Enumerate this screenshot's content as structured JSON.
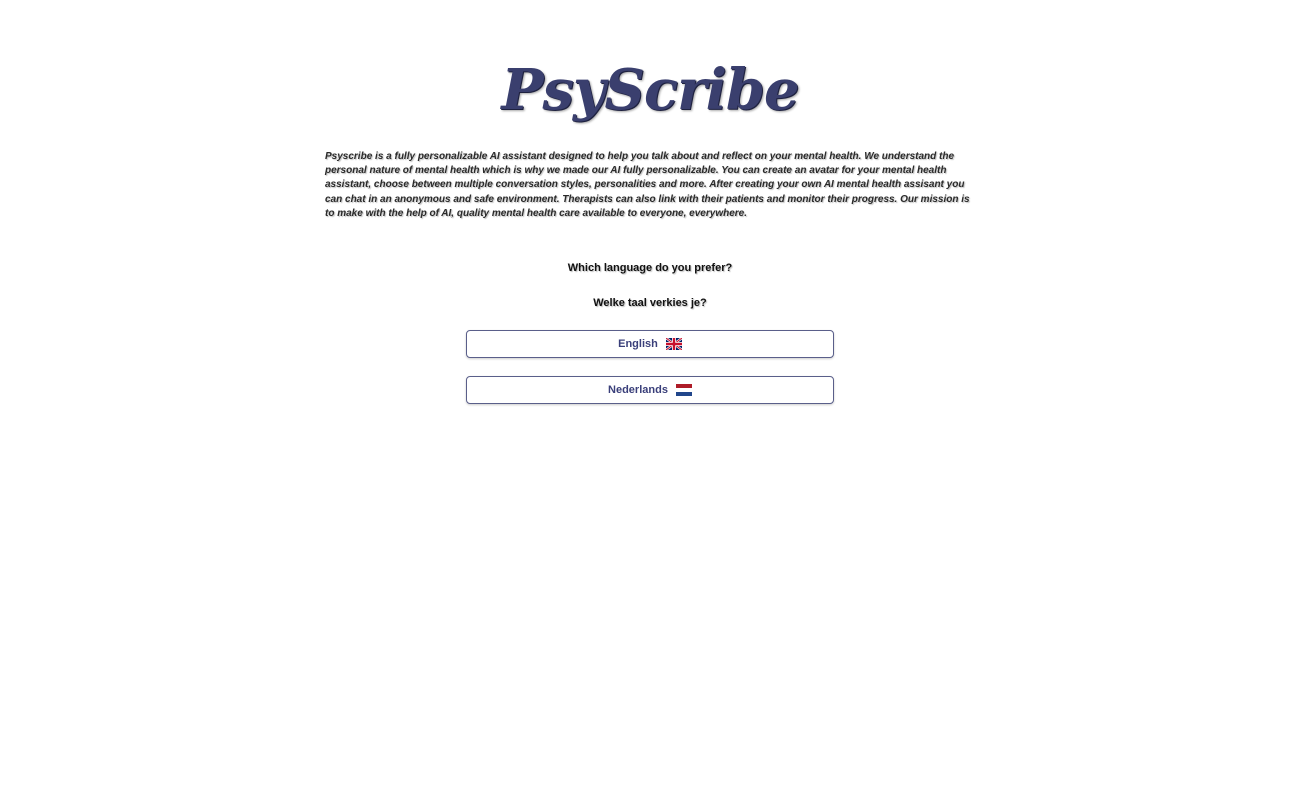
{
  "header": {
    "logo_text": "PsyScribe"
  },
  "intro": {
    "text": "Psyscribe is a fully personalizable AI assistant designed to help you talk about and reflect on your mental health. We understand the personal nature of mental health which is why we made our AI fully personalizable. You can create an avatar for your mental health assistant, choose between multiple conversation styles, personalities and more. After creating your own AI mental health assisant you can chat in an anonymous and safe environment. Therapists can also link with their patients and monitor their progress. Our mission is to make with the help of AI, quality mental health care available to everyone, everywhere."
  },
  "language_prompt": {
    "english": "Which language do you prefer?",
    "dutch": "Welke taal verkies je?"
  },
  "language_options": [
    {
      "label": "English",
      "flag_icon": "uk-flag-icon"
    },
    {
      "label": "Nederlands",
      "flag_icon": "netherlands-flag-icon"
    }
  ],
  "colors": {
    "brand": "#3a3f6e",
    "button_border": "#5a5f8a",
    "button_text": "#3a3f7a",
    "background": "#ffffff"
  }
}
